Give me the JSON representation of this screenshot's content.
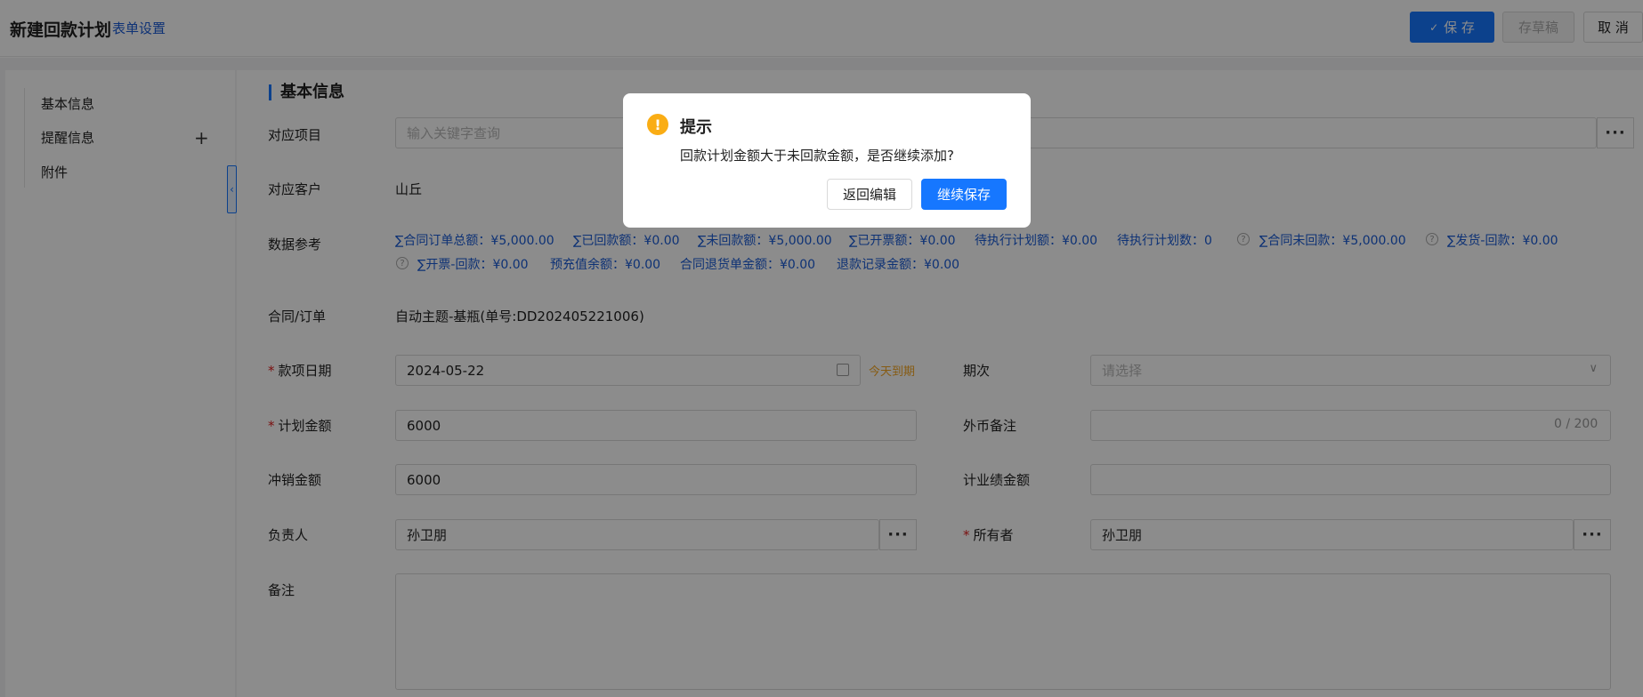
{
  "header": {
    "title": "新建回款计划",
    "settings_link": "表单设置",
    "save_label": "保 存",
    "save_icon": "✓",
    "draft_label": "存草稿",
    "cancel_label": "取 消"
  },
  "sidebar": {
    "items": [
      {
        "label": "基本信息"
      },
      {
        "label": "提醒信息",
        "action": "+"
      },
      {
        "label": "附件"
      }
    ],
    "collapse_icon": "‹"
  },
  "form": {
    "section_title": "基本信息",
    "project": {
      "label": "对应项目",
      "placeholder": "输入关键字查询"
    },
    "customer": {
      "label": "对应客户",
      "value": "山丘"
    },
    "reference": {
      "label": "数据参考",
      "line1": [
        "∑合同订单总额：¥5,000.00",
        "∑已回款额：¥0.00",
        "∑未回款额：¥5,000.00",
        "∑已开票额：¥0.00",
        "待执行计划额：¥0.00",
        "待执行计划数：0",
        "∑合同未回款：¥5,000.00",
        "∑发货-回款：¥0.00"
      ],
      "line2": [
        "∑开票-回款：¥0.00",
        "预充值余额：¥0.00",
        "合同退货单金额：¥0.00",
        "退款记录金额：¥0.00"
      ]
    },
    "contract": {
      "label": "合同/订单",
      "value": "自动主题-基瓶(单号:DD202405221006)"
    },
    "due_date": {
      "label": "款项日期",
      "value": "2024-05-22",
      "hint": "今天到期"
    },
    "period": {
      "label": "期次",
      "placeholder": "请选择"
    },
    "plan_amount": {
      "label": "计划金额",
      "value": "6000"
    },
    "fx_note": {
      "label": "外币备注",
      "counter": "0 / 200"
    },
    "writeoff": {
      "label": "冲销金额",
      "value": "6000"
    },
    "performance": {
      "label": "计业绩金额",
      "value": ""
    },
    "owner_resp": {
      "label": "负责人",
      "value": "孙卫朋"
    },
    "owner": {
      "label": "所有者",
      "value": "孙卫朋"
    },
    "remark": {
      "label": "备注"
    },
    "required_mark": "*",
    "dots": "···"
  },
  "dialog": {
    "icon": "!",
    "title": "提示",
    "message": "回款计划金额大于未回款金额，是否继续添加?",
    "back_label": "返回编辑",
    "continue_label": "继续保存"
  },
  "colors": {
    "primary": "#1677ff",
    "link": "#1a5bd6",
    "warning": "#faad14",
    "required": "#e02020"
  }
}
